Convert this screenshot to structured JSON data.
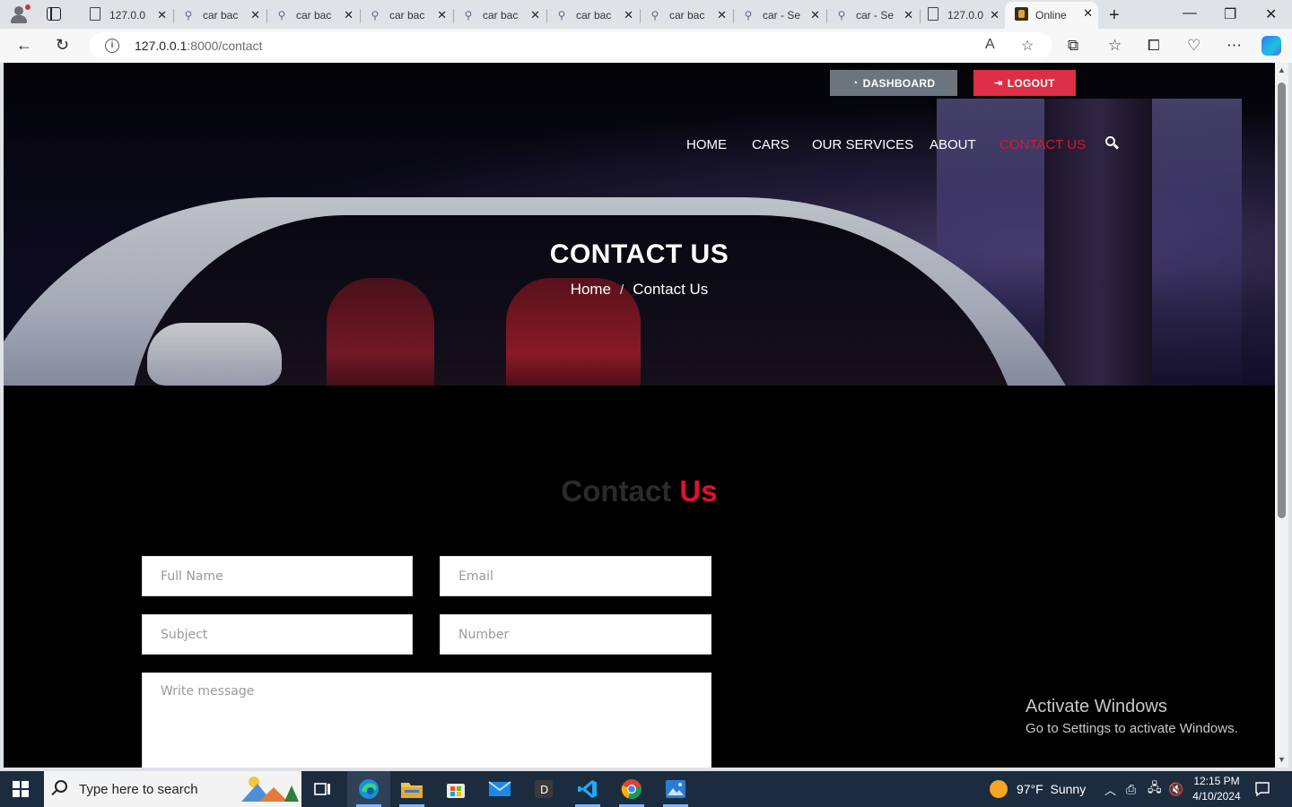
{
  "browser": {
    "tabs": [
      {
        "label": "127.0.0",
        "icon": "page-icon"
      },
      {
        "label": "car bac",
        "icon": "search-icon"
      },
      {
        "label": "car bac",
        "icon": "search-icon"
      },
      {
        "label": "car bac",
        "icon": "search-icon"
      },
      {
        "label": "car bac",
        "icon": "search-icon"
      },
      {
        "label": "car bac",
        "icon": "search-icon"
      },
      {
        "label": "car bac",
        "icon": "search-icon"
      },
      {
        "label": "car - Se",
        "icon": "search-icon"
      },
      {
        "label": "car - Se",
        "icon": "search-icon"
      },
      {
        "label": "127.0.0",
        "icon": "page-icon"
      },
      {
        "label": "Online",
        "icon": "site-favicon",
        "active": true
      }
    ],
    "url_host": "127.0.0.1",
    "url_path": ":8000/contact"
  },
  "site": {
    "dashboard_label": "DASHBOARD",
    "logout_label": "LOGOUT",
    "nav": [
      "HOME",
      "CARS",
      "OUR SERVICES",
      "ABOUT",
      "CONTACT US"
    ],
    "active_nav": "CONTACT US",
    "hero_title": "CONTACT US",
    "breadcrumb": {
      "home": "Home",
      "separator": "/",
      "current": "Contact Us"
    },
    "section_title_part1": "Contact",
    "section_title_part2": "Us",
    "form": {
      "full_name_placeholder": "Full Name",
      "email_placeholder": "Email",
      "subject_placeholder": "Subject",
      "number_placeholder": "Number",
      "message_placeholder": "Write message"
    },
    "colors": {
      "accent": "#e1112d",
      "dashboard_button": "#6c757d",
      "logout_button": "#dc2f45"
    }
  },
  "watermark": {
    "line1": "Activate Windows",
    "line2": "Go to Settings to activate Windows."
  },
  "taskbar": {
    "search_placeholder": "Type here to search",
    "weather": "97°F  Sunny",
    "time": "12:15 PM",
    "date": "4/10/2024"
  }
}
